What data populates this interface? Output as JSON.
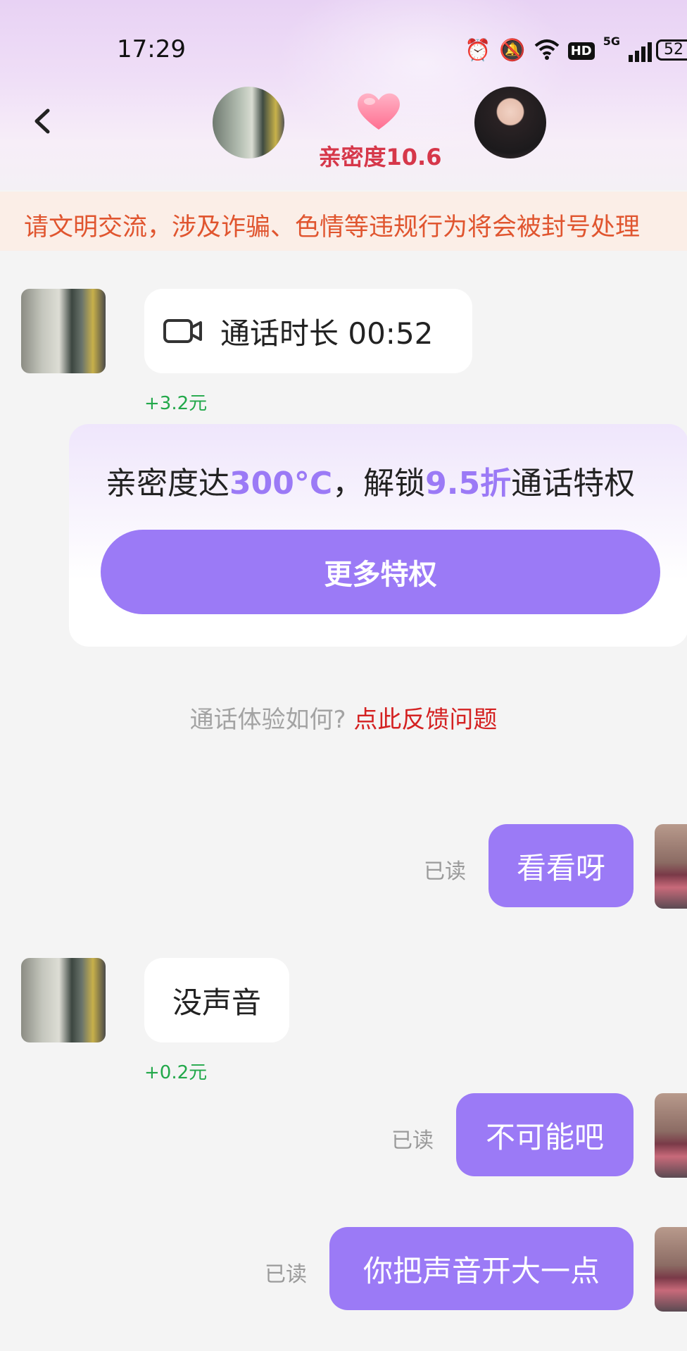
{
  "status_bar": {
    "time": "17:29",
    "hd": "HD",
    "network": "5G",
    "battery": "52"
  },
  "header": {
    "intimacy_label": "亲密度10.6",
    "icons": [
      "back-chevron-icon",
      "heart-icon"
    ]
  },
  "notice": {
    "text": "请文明交流，涉及诈骗、色情等违规行为将会被封号处理"
  },
  "messages": {
    "call_record": {
      "label": "通话时长 00:52",
      "earned": "+3.2元",
      "icon": "video-camera-icon"
    },
    "promo": {
      "text_prefix": "亲密度达",
      "text_highlight1": "300°C",
      "text_middle": "，解锁",
      "text_highlight2": "9.5折",
      "text_suffix": "通话特权",
      "button_label": "更多特权"
    },
    "feedback": {
      "question": "通话体验如何?",
      "link": "点此反馈问题"
    },
    "out1": {
      "text": "看看呀",
      "status": "已读"
    },
    "in2": {
      "text": "没声音",
      "earned": "+0.2元"
    },
    "out2": {
      "text": "不可能吧",
      "status": "已读"
    },
    "out3": {
      "text": "你把声音开大一点",
      "status": "已读"
    }
  },
  "colors": {
    "accent": "#9b7af6",
    "notice_text": "#e0552f",
    "intimacy": "#d6374a",
    "earned": "#22a84a",
    "feedback_link": "#d42222"
  }
}
